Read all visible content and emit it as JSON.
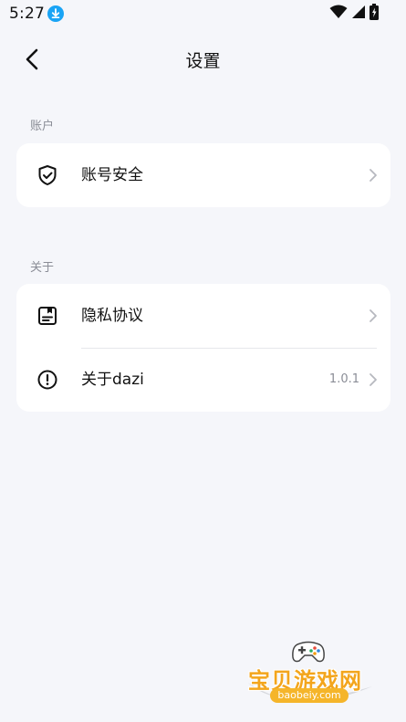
{
  "status_bar": {
    "time": "5:27",
    "icons": [
      "download-icon",
      "wifi-icon",
      "signal-icon",
      "battery-icon"
    ]
  },
  "header": {
    "title": "设置",
    "back_icon": "chevron-left-icon"
  },
  "sections": [
    {
      "label": "账户",
      "items": [
        {
          "icon": "shield-check-icon",
          "label": "账号安全",
          "value": ""
        }
      ]
    },
    {
      "label": "关于",
      "items": [
        {
          "icon": "document-icon",
          "label": "隐私协议",
          "value": ""
        },
        {
          "icon": "info-alert-icon",
          "label": "关于dazi",
          "value": "1.0.1"
        }
      ]
    }
  ],
  "watermark": {
    "text": "宝贝游戏网",
    "url": "baobeiy.com"
  },
  "colors": {
    "background": "#f5f6fa",
    "card": "#ffffff",
    "secondary_text": "#8a8d96",
    "download_badge": "#1aa4f5",
    "watermark": "#f3a51c"
  }
}
